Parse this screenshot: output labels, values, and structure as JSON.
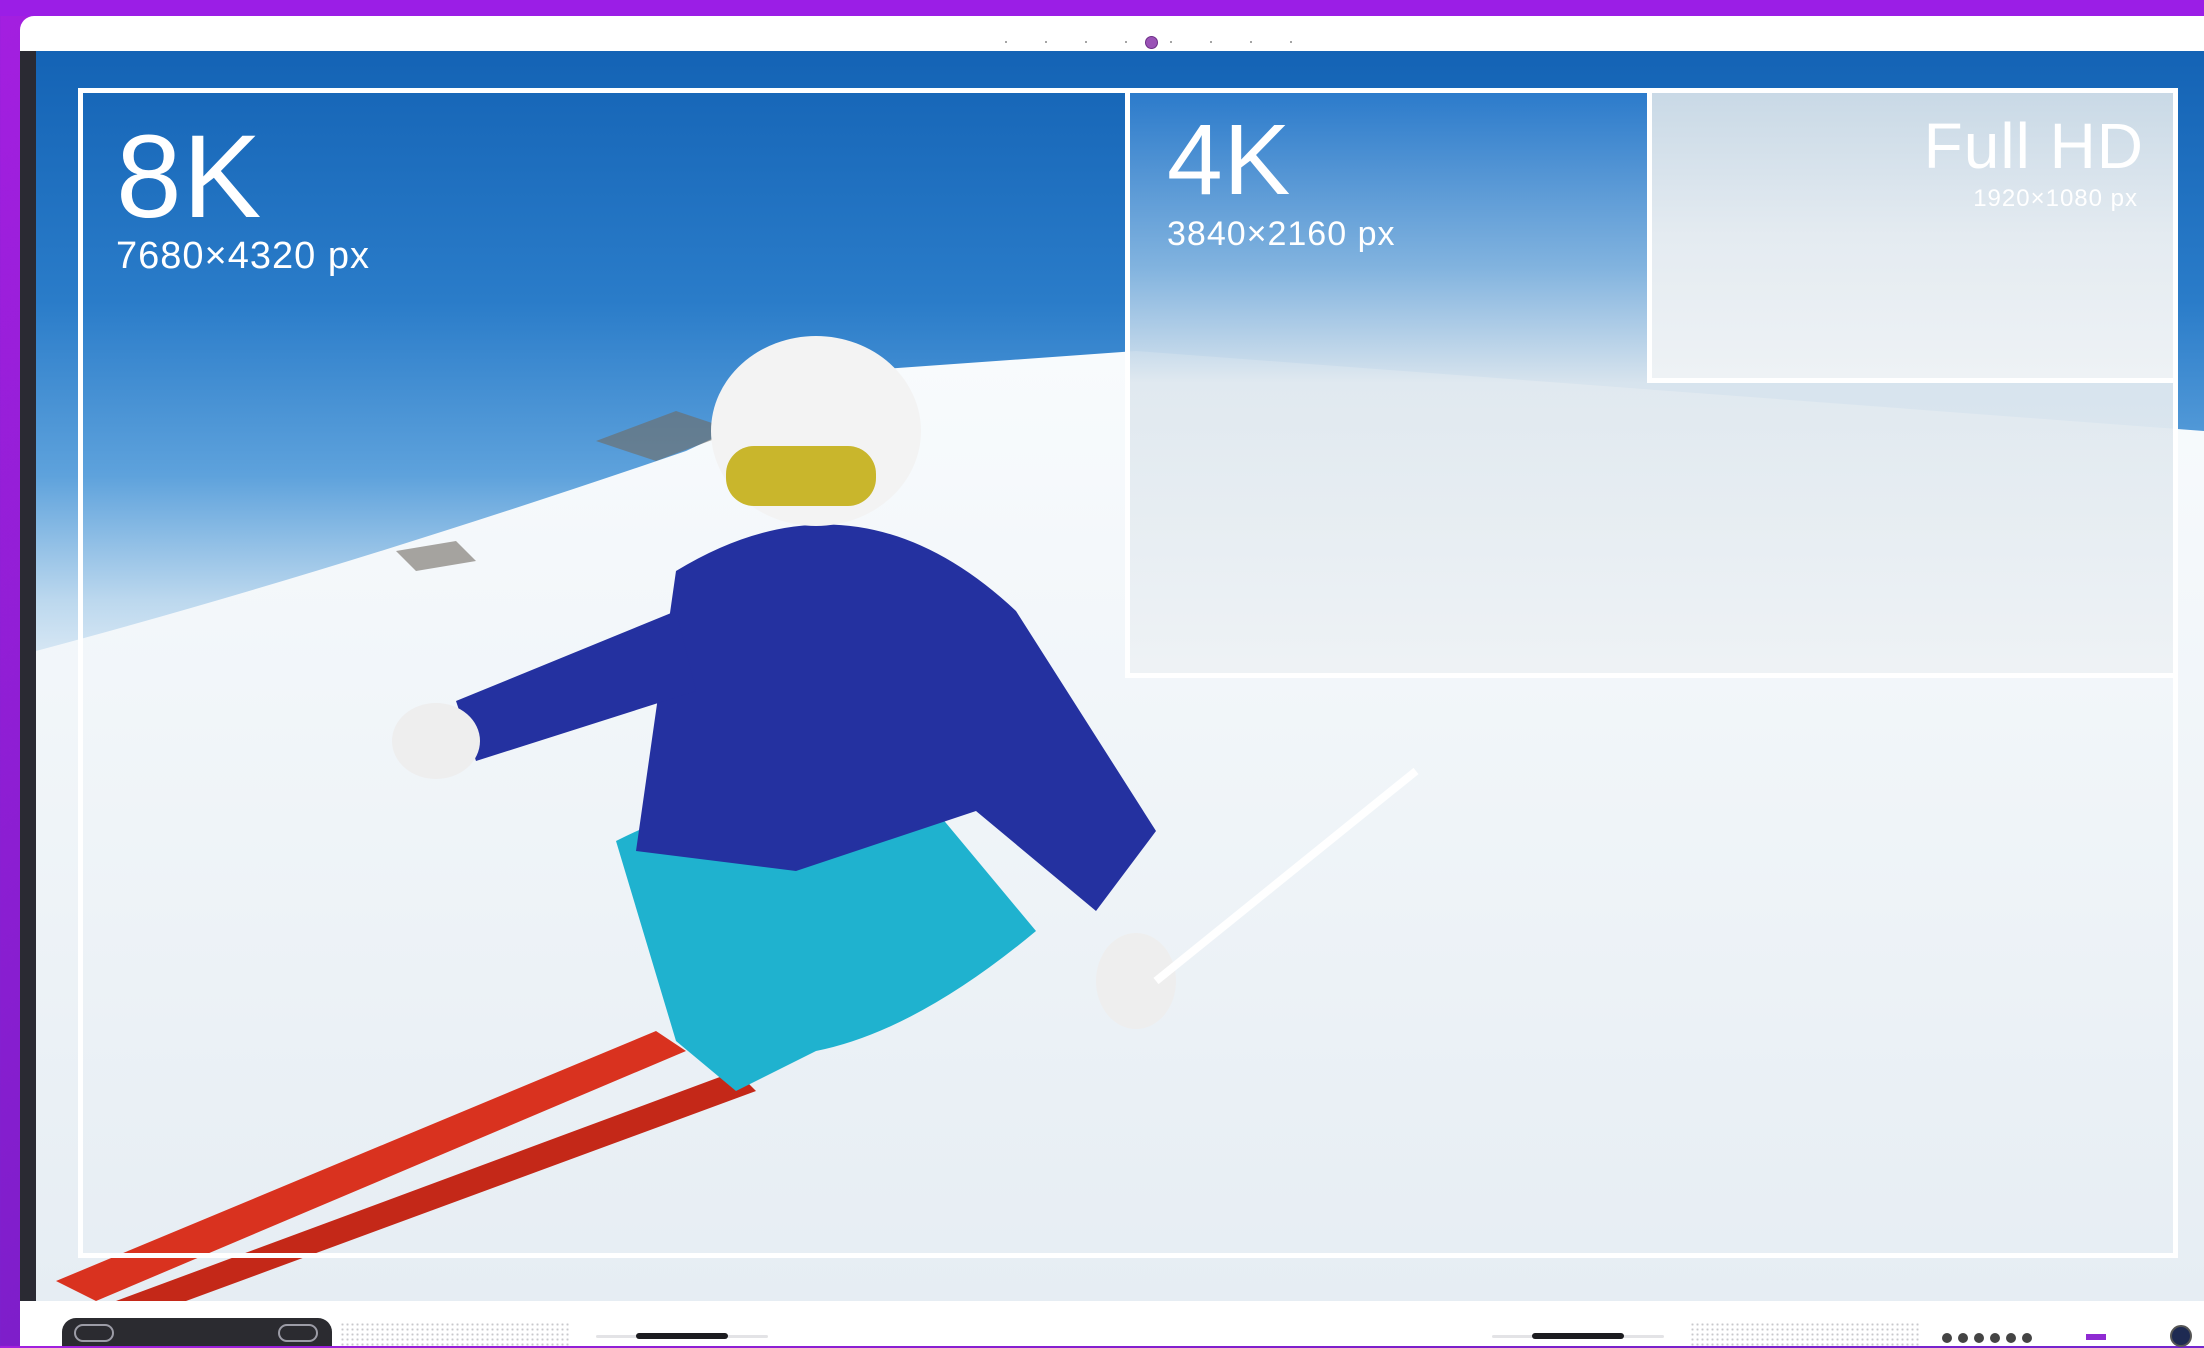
{
  "resolutions": [
    {
      "title": "8K",
      "pixels": "7680×4320 px"
    },
    {
      "title": "4K",
      "pixels": "3840×2160 px"
    },
    {
      "title": "Full HD",
      "pixels": "1920×1080 px"
    }
  ],
  "colors": {
    "frame_border": "#ffffff",
    "background_accent": "#9b1ee6",
    "indicator_accent": "#8f2bd2"
  },
  "icons": {
    "camera": "camera-icon",
    "wireless": "wireless-icon",
    "power": "power-icon"
  }
}
